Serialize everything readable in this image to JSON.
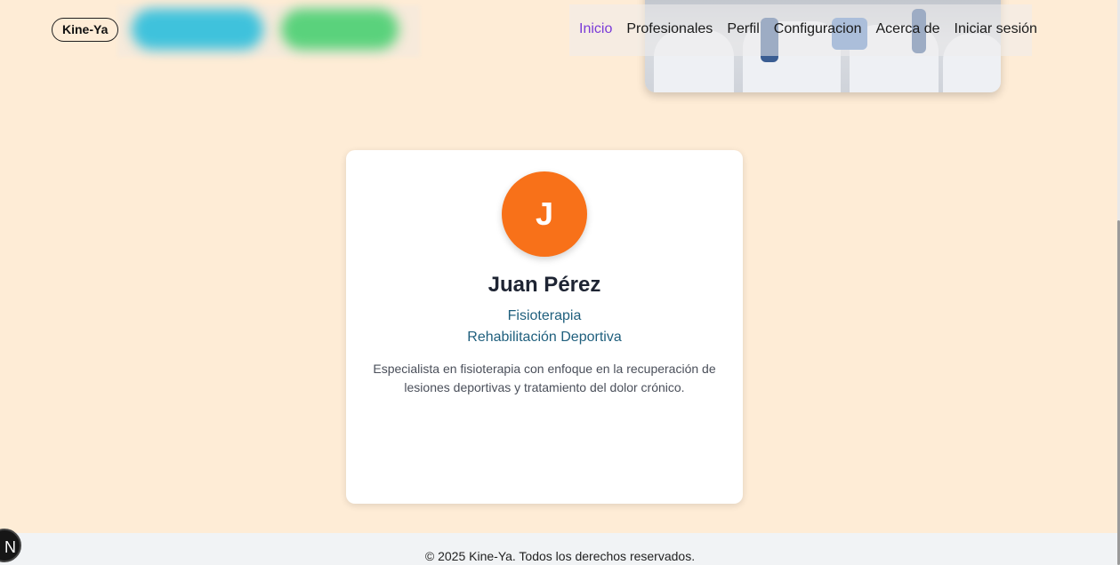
{
  "header": {
    "logo": "Kine-Ya",
    "nav": [
      {
        "label": "Inicio",
        "active": true
      },
      {
        "label": "Profesionales",
        "active": false
      },
      {
        "label": "Perfil",
        "active": false
      },
      {
        "label": "Configuracion",
        "active": false
      },
      {
        "label": "Acerca de",
        "active": false
      },
      {
        "label": "Iniciar sesión",
        "active": false
      }
    ],
    "hero_image": "doctors-team-photo"
  },
  "card": {
    "avatar_initial": "J",
    "name": "Juan Pérez",
    "specialties": [
      "Fisioterapia",
      "Rehabilitación Deportiva"
    ],
    "description": "Especialista en fisioterapia con enfoque en la recuperación de lesiones deportivas y tratamiento del dolor crónico."
  },
  "footer": {
    "text": "© 2025 Kine-Ya. Todos los derechos reservados."
  },
  "dev_badge": "N",
  "colors": {
    "background": "#feecd6",
    "avatar": "#f87119",
    "active_nav": "#7a3bd8",
    "specialty": "#1f5f7d"
  }
}
